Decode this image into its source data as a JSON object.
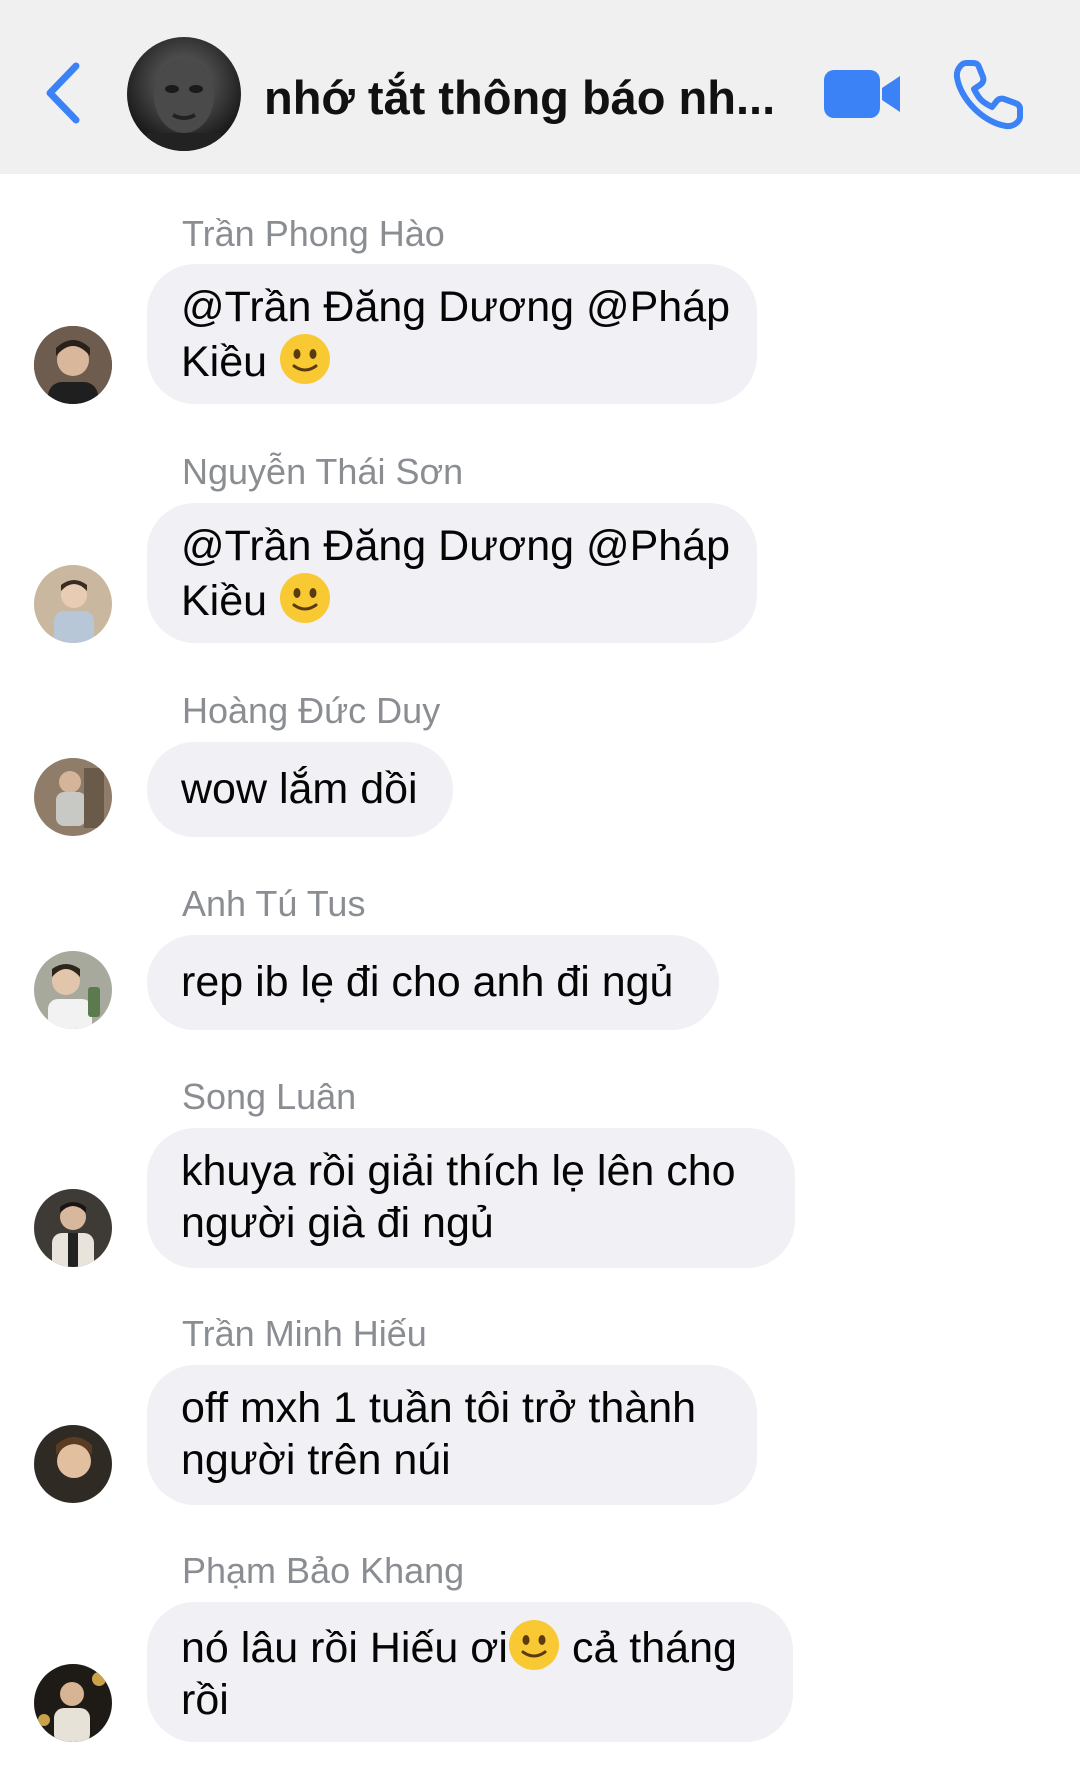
{
  "header": {
    "title": "nhớ tắt thông báo nh...",
    "accent_color": "#3b82f6",
    "icons": [
      "chevron-left-icon",
      "video-camera-icon",
      "phone-icon"
    ]
  },
  "messages": [
    {
      "sender": "Trần Phong Hào",
      "lines": [
        "@Trần Đăng Dương @Pháp",
        "Kiều"
      ],
      "emoji_after": "slightly-smiling-face"
    },
    {
      "sender": "Nguyễn Thái Sơn",
      "lines": [
        "@Trần Đăng Dương @Pháp",
        "Kiều"
      ],
      "emoji_after": "slightly-smiling-face"
    },
    {
      "sender": "Hoàng Đức Duy",
      "lines": [
        "wow lắm dồi"
      ]
    },
    {
      "sender": "Anh Tú Tus",
      "lines": [
        "rep ib lẹ đi cho anh đi ngủ"
      ]
    },
    {
      "sender": "Song Luân",
      "lines": [
        "khuya rồi giải thích lẹ lên cho",
        "người già đi ngủ"
      ]
    },
    {
      "sender": "Trần Minh Hiếu",
      "lines": [
        "off mxh 1 tuần tôi trở thành",
        "người trên núi"
      ]
    },
    {
      "sender": "Phạm Bảo Khang",
      "lines": [
        "nó lâu rồi Hiếu ơi",
        "cả tháng",
        "rồi"
      ]
    }
  ],
  "bubble_color": "#f0f0f5",
  "sender_color": "#8a8d91"
}
